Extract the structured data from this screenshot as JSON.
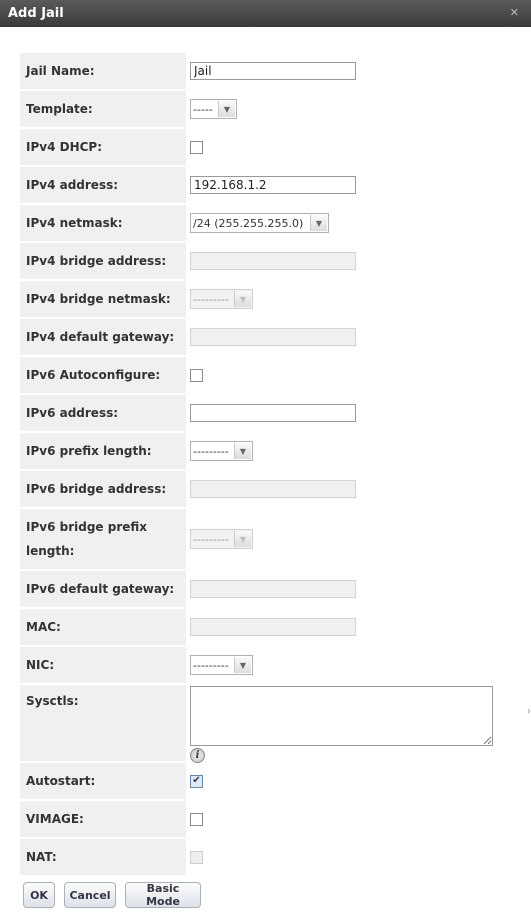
{
  "dialog": {
    "title": "Add Jail",
    "close_glyph": "✕"
  },
  "fields": {
    "jail_name": {
      "label": "Jail Name:",
      "value": "Jail"
    },
    "template": {
      "label": "Template:",
      "value": "-----"
    },
    "ipv4_dhcp": {
      "label": "IPv4 DHCP:",
      "checked": false
    },
    "ipv4_address": {
      "label": "IPv4 address:",
      "value": "192.168.1.2"
    },
    "ipv4_netmask": {
      "label": "IPv4 netmask:",
      "value": "/24 (255.255.255.0)"
    },
    "ipv4_bridge_address": {
      "label": "IPv4 bridge address:",
      "value": ""
    },
    "ipv4_bridge_netmask": {
      "label": "IPv4 bridge netmask:",
      "value": "---------"
    },
    "ipv4_default_gateway": {
      "label": "IPv4 default gateway:",
      "value": ""
    },
    "ipv6_autoconfigure": {
      "label": "IPv6 Autoconfigure:",
      "checked": false
    },
    "ipv6_address": {
      "label": "IPv6 address:",
      "value": ""
    },
    "ipv6_prefix_length": {
      "label": "IPv6 prefix length:",
      "value": "---------"
    },
    "ipv6_bridge_address": {
      "label": "IPv6 bridge address:",
      "value": ""
    },
    "ipv6_bridge_prefix_length": {
      "label_line1": "IPv6 bridge prefix",
      "label_line2": "length:",
      "value": "---------"
    },
    "ipv6_default_gateway": {
      "label": "IPv6 default gateway:",
      "value": ""
    },
    "mac": {
      "label": "MAC:",
      "value": ""
    },
    "nic": {
      "label": "NIC:",
      "value": "---------"
    },
    "sysctls": {
      "label": "Sysctls:",
      "value": "",
      "help_glyph": "i"
    },
    "autostart": {
      "label": "Autostart:",
      "checked": true
    },
    "vimage": {
      "label": "VIMAGE:",
      "checked": false
    },
    "nat": {
      "label": "NAT:",
      "checked": false
    }
  },
  "buttons": {
    "ok": "OK",
    "cancel": "Cancel",
    "basic_mode": "Basic Mode"
  }
}
